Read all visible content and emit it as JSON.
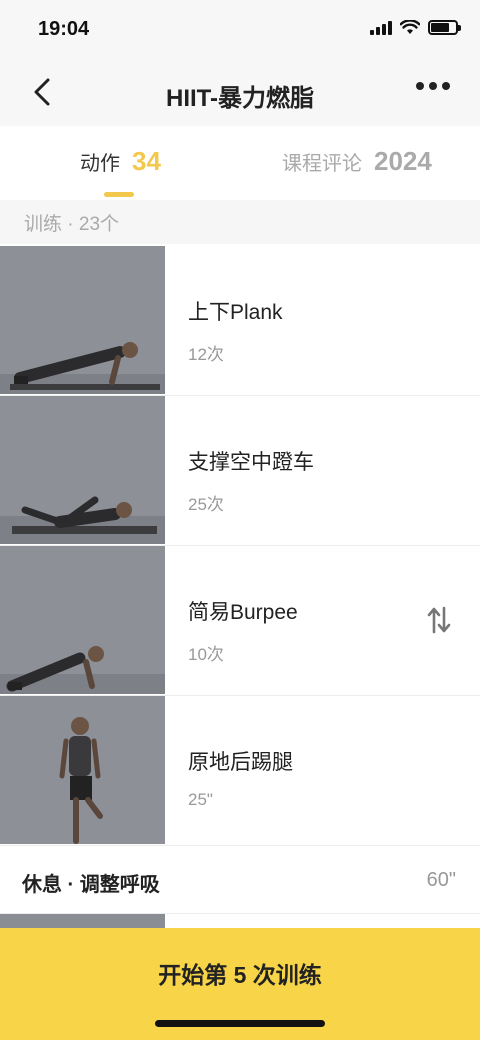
{
  "status_bar": {
    "time": "19:04"
  },
  "nav": {
    "title": "HIIT-暴力燃脂"
  },
  "tabs": [
    {
      "label": "动作",
      "count": "34"
    },
    {
      "label": "课程评论",
      "count": "2024"
    }
  ],
  "section": {
    "label": "训练 · 23个"
  },
  "exercises": [
    {
      "name": "上下Plank",
      "detail": "12次"
    },
    {
      "name": "支撑空中蹬车",
      "detail": "25次"
    },
    {
      "name": "简易Burpee",
      "detail": "10次"
    },
    {
      "name": "原地后踢腿",
      "detail": "25\""
    }
  ],
  "rest": {
    "label": "休息 · 调整呼吸",
    "duration": "60\""
  },
  "start_button": {
    "label": "开始第 5 次训练"
  },
  "colors": {
    "accent": "#f2c94c",
    "button": "#f8d548"
  }
}
